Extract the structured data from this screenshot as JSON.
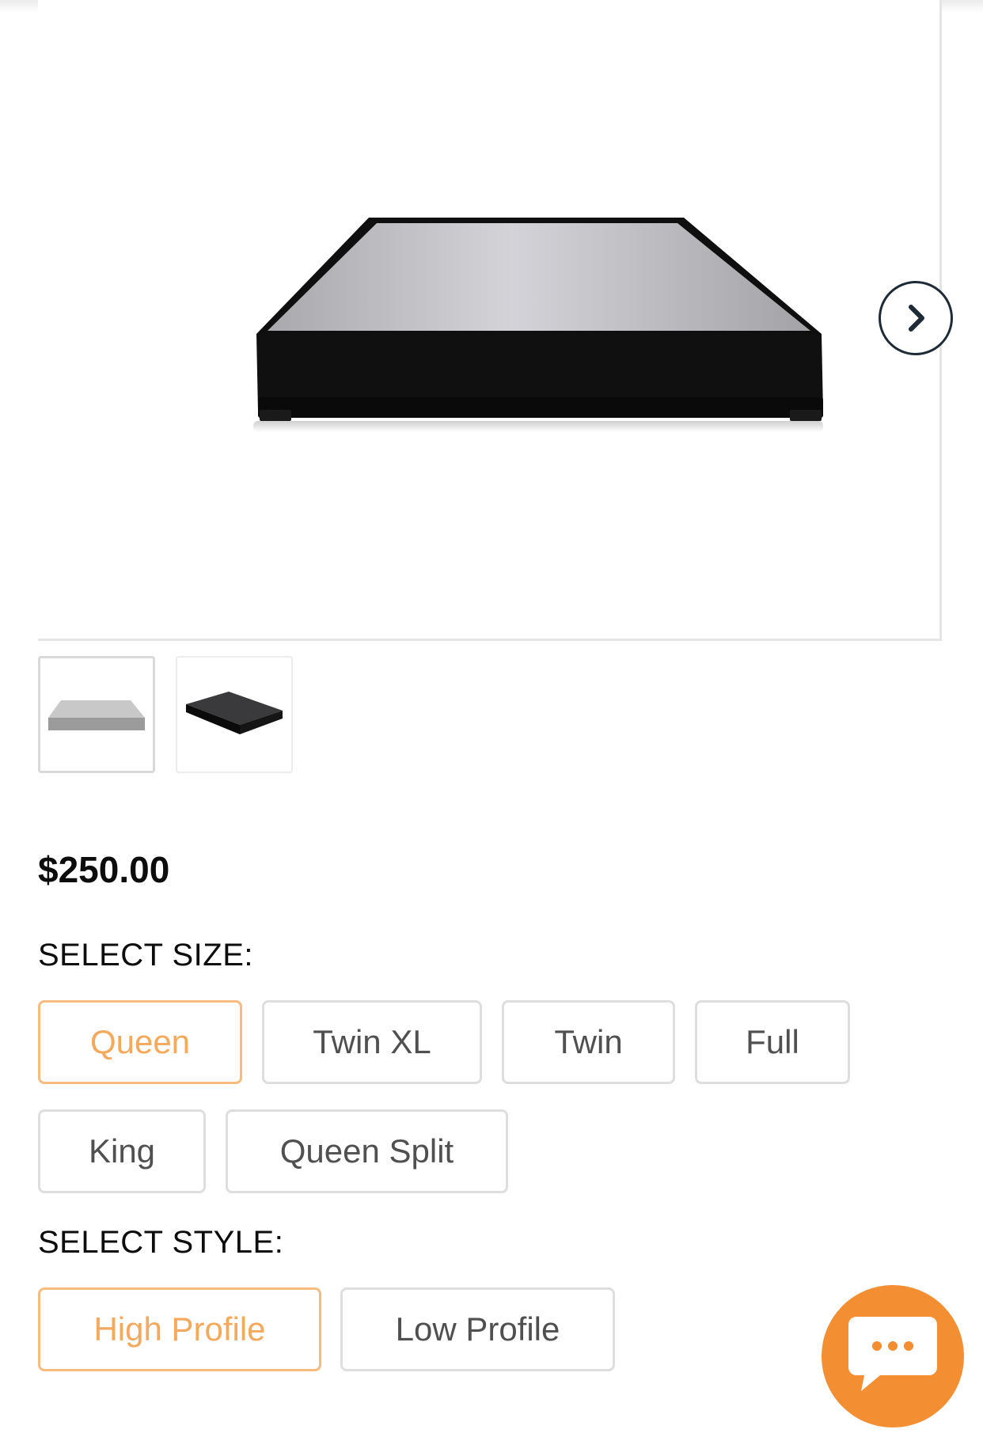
{
  "product": {
    "price": "$250.00",
    "image_alt": "Foundation base, black sides with gray top"
  },
  "gallery": {
    "next_icon": "chevron-right-icon",
    "thumbnails": [
      {
        "name": "thumbnail-gray-foundation",
        "state": "selected"
      },
      {
        "name": "thumbnail-black-foundation",
        "state": "unselected"
      }
    ]
  },
  "size": {
    "label": "SELECT SIZE:",
    "options": [
      "Queen",
      "Twin XL",
      "Twin",
      "Full",
      "King",
      "Queen Split"
    ],
    "selected": "Queen"
  },
  "style": {
    "label": "SELECT STYLE:",
    "options": [
      "High Profile",
      "Low Profile"
    ],
    "selected": "High Profile"
  },
  "chat": {
    "icon": "chat-bubble-icon"
  },
  "colors": {
    "accent": "#f38e33",
    "selected_text": "#f4a95c",
    "selected_border": "#f6bb7f",
    "option_border": "#dedede",
    "text_dark": "#0d0d0d"
  }
}
